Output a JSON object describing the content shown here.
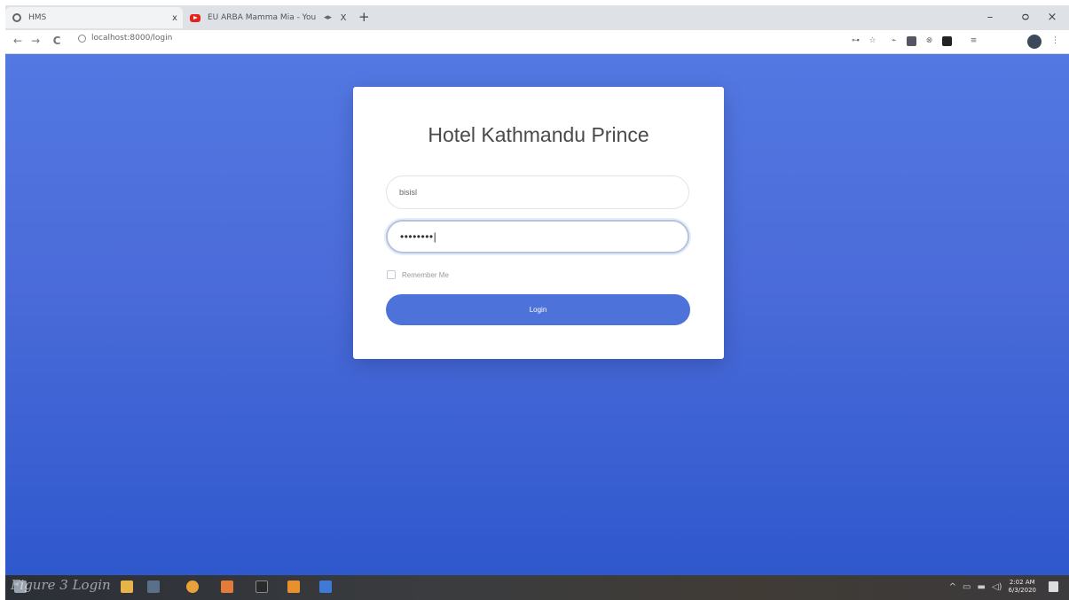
{
  "browser": {
    "tabs": [
      {
        "title": "HMS",
        "favicon": "globe-icon",
        "close": "x"
      },
      {
        "title": "EU ARBA Mamma Mia - You",
        "favicon": "youtube-icon",
        "close": "X"
      }
    ],
    "new_tab": "+",
    "window_controls": {
      "minimize": "–",
      "maximize": "ᴑ",
      "close": "×"
    },
    "nav": {
      "back": "←",
      "forward": "→",
      "reload": "C"
    },
    "url": "localhost:8000/login",
    "extension_icons": [
      "key-icon",
      "star-icon",
      "puzzle-icon",
      "extension-icon",
      "extension-icon",
      "extension-icon",
      "media-icon"
    ]
  },
  "login": {
    "title": "Hotel Kathmandu Prince",
    "email_value": "bisisl",
    "password_value": "••••••••|",
    "remember_label": "Remember Me",
    "button_label": "Login"
  },
  "taskbar": {
    "caption": "Figure 3 Login",
    "time": "2:02 AM",
    "date": "6/3/2020",
    "tray_icons": [
      "chevron-up-icon",
      "display-icon",
      "battery-icon",
      "volume-icon"
    ]
  },
  "colors": {
    "page_gradient_top": "#5378e2",
    "page_gradient_bottom": "#2f58cd",
    "button": "#4d72d9",
    "card": "#ffffff"
  }
}
